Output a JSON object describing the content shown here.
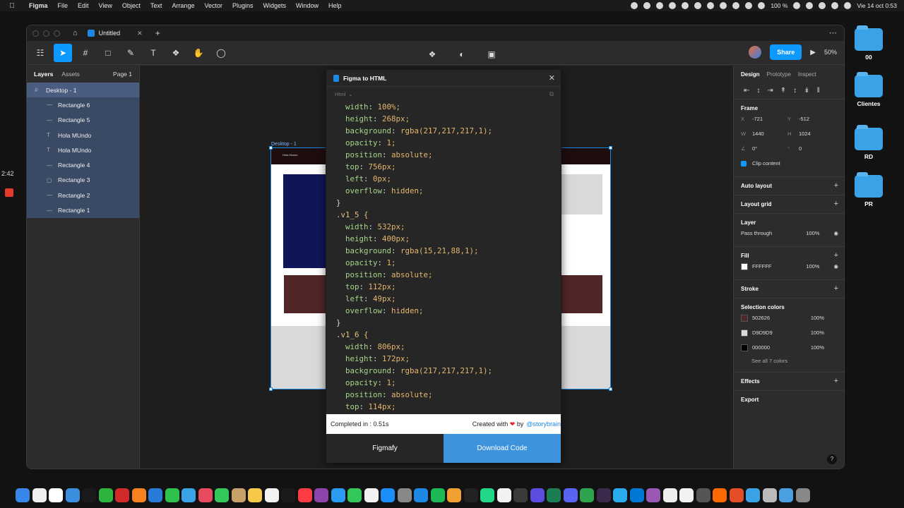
{
  "menubar": {
    "apple": "",
    "items": [
      "Figma",
      "File",
      "Edit",
      "View",
      "Object",
      "Text",
      "Arrange",
      "Vector",
      "Plugins",
      "Widgets",
      "Window",
      "Help"
    ],
    "battery": "100 %",
    "datetime": "Vie 14 oct  0:53"
  },
  "side": {
    "timer": "2:42"
  },
  "desktop_folders": [
    {
      "label": "00"
    },
    {
      "label": "Clientes"
    },
    {
      "label": "RD"
    },
    {
      "label": "PR"
    }
  ],
  "window": {
    "tab_title": "Untitled",
    "share_label": "Share",
    "zoom": "50%"
  },
  "left_panel": {
    "tabs": [
      "Layers",
      "Assets"
    ],
    "page": "Page 1",
    "top_layer": "Desktop - 1",
    "layers": [
      {
        "icon": "—",
        "name": "Rectangle 6"
      },
      {
        "icon": "—",
        "name": "Rectangle 5"
      },
      {
        "icon": "T",
        "name": "Hola MUndo"
      },
      {
        "icon": "T",
        "name": "Hola MUndo"
      },
      {
        "icon": "—",
        "name": "Rectangle 4"
      },
      {
        "icon": "▢",
        "name": "Rectangle 3"
      },
      {
        "icon": "—",
        "name": "Rectangle 2"
      },
      {
        "icon": "—",
        "name": "Rectangle 1"
      }
    ]
  },
  "canvas": {
    "frame_label": "Desktop - 1",
    "frame_text": "Hola Mundo"
  },
  "plugin": {
    "title": "Figma to HTML",
    "select_value": "Html",
    "code_lines": [
      {
        "type": "prop",
        "k": "width",
        "v": "100%;"
      },
      {
        "type": "prop",
        "k": "height",
        "v": "268px;"
      },
      {
        "type": "prop",
        "k": "background",
        "v": "rgba(217,217,217,1);"
      },
      {
        "type": "prop",
        "k": "opacity",
        "v": "1;"
      },
      {
        "type": "prop",
        "k": "position",
        "v": "absolute;"
      },
      {
        "type": "prop",
        "k": "top",
        "v": "756px;"
      },
      {
        "type": "prop",
        "k": "left",
        "v": "0px;"
      },
      {
        "type": "prop",
        "k": "overflow",
        "v": "hidden;"
      },
      {
        "type": "close",
        "t": "}"
      },
      {
        "type": "sel",
        "t": ".v1_5 {"
      },
      {
        "type": "prop",
        "k": "width",
        "v": "532px;"
      },
      {
        "type": "prop",
        "k": "height",
        "v": "400px;"
      },
      {
        "type": "prop",
        "k": "background",
        "v": "rgba(15,21,88,1);"
      },
      {
        "type": "prop",
        "k": "opacity",
        "v": "1;"
      },
      {
        "type": "prop",
        "k": "position",
        "v": "absolute;"
      },
      {
        "type": "prop",
        "k": "top",
        "v": "112px;"
      },
      {
        "type": "prop",
        "k": "left",
        "v": "49px;"
      },
      {
        "type": "prop",
        "k": "overflow",
        "v": "hidden;"
      },
      {
        "type": "close",
        "t": "}"
      },
      {
        "type": "sel",
        "t": ".v1_6 {"
      },
      {
        "type": "prop",
        "k": "width",
        "v": "806px;"
      },
      {
        "type": "prop",
        "k": "height",
        "v": "172px;"
      },
      {
        "type": "prop",
        "k": "background",
        "v": "rgba(217,217,217,1);"
      },
      {
        "type": "prop",
        "k": "opacity",
        "v": "1;"
      },
      {
        "type": "prop",
        "k": "position",
        "v": "absolute;"
      },
      {
        "type": "prop",
        "k": "top",
        "v": "114px;"
      }
    ],
    "completed": "Completed in : 0.51s",
    "created_with": "Created with",
    "by": "by",
    "author": "@storybrain",
    "btn_figmafy": "Figmafy",
    "btn_download": "Download Code"
  },
  "right_panel": {
    "tabs": [
      "Design",
      "Prototype",
      "Inspect"
    ],
    "frame_title": "Frame",
    "x": "-721",
    "y": "-512",
    "w": "1440",
    "h": "1024",
    "rotation": "0°",
    "radius": "0",
    "clip_content": "Clip content",
    "auto_layout": "Auto layout",
    "layout_grid": "Layout grid",
    "layer_title": "Layer",
    "pass_through": "Pass through",
    "layer_opacity": "100%",
    "fill_title": "Fill",
    "fill_hex": "FFFFFF",
    "fill_opacity": "100%",
    "stroke_title": "Stroke",
    "selection_colors_title": "Selection colors",
    "selection_colors": [
      {
        "hex": "502626",
        "pct": "100%",
        "swatch": "#502626"
      },
      {
        "hex": "D9D9D9",
        "pct": "100%",
        "swatch": "#D9D9D9"
      },
      {
        "hex": "000000",
        "pct": "100%",
        "swatch": "#000000"
      }
    ],
    "see_all": "See all 7 colors",
    "effects_title": "Effects",
    "export_title": "Export"
  },
  "dock_colors": [
    "#3a86e8",
    "#f0f0f0",
    "#ffffff",
    "#3b8ede",
    "#1a1a1a",
    "#2fb33f",
    "#d22a2a",
    "#f5821f",
    "#2a7ad8",
    "#2ec24d",
    "#3aa3e8",
    "#e84a5f",
    "#34c759",
    "#c8a06a",
    "#f7c948",
    "#f2f2f2",
    "#1a1a1a",
    "#fc3c44",
    "#8e44ad",
    "#2b9af3",
    "#34c759",
    "#f2f2f2",
    "#1c8ef9",
    "#888888",
    "#1e88e5",
    "#1db954",
    "#f0a030",
    "#222222",
    "#21d789",
    "#f2f2f2",
    "#3a3a3a",
    "#5b4de0",
    "#1c7c54",
    "#5865f2",
    "#2ea44f",
    "#3c2a4d",
    "#2aabee",
    "#0078d4",
    "#9b59b6",
    "#eeeeee",
    "#f2f2f2",
    "#555555",
    "#ff6a00",
    "#e44d26",
    "#3aa3e8",
    "#bbbbbb",
    "#4a9fe0",
    "#888888"
  ],
  "colors": {
    "accent": "#0d99ff",
    "navy": "#0f1558",
    "maroon": "#502626",
    "gray": "#d9d9d9"
  }
}
